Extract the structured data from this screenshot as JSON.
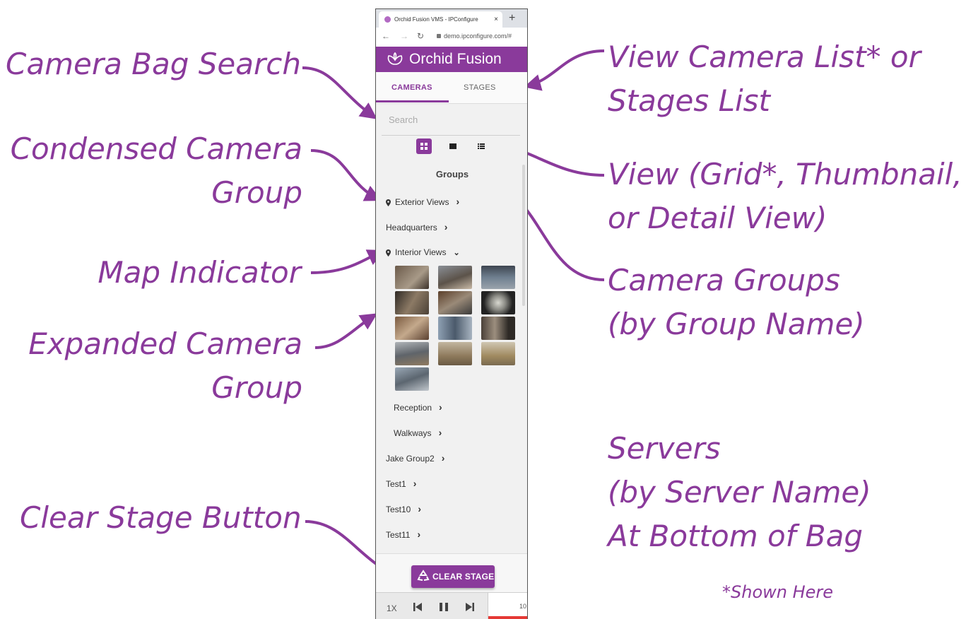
{
  "colors": {
    "accent": "#8a3a9b",
    "clear_stage_bg": "#8a3a9b",
    "timeline_red": "#e53935"
  },
  "callouts": {
    "camera_bag_search": "Camera Bag Search",
    "condensed_1": "Condensed Camera",
    "condensed_2": "Group",
    "map_indicator": "Map Indicator",
    "expanded_1": "Expanded Camera",
    "expanded_2": "Group",
    "clear_stage": "Clear Stage Button",
    "view_list_1": "View Camera List* or",
    "view_list_2": "Stages List",
    "view_mode_1": "View (Grid*, Thumbnail,",
    "view_mode_2": "or Detail View)",
    "camera_groups_1": "Camera Groups",
    "camera_groups_2": "(by Group Name)",
    "servers_1": "Servers",
    "servers_2": "(by Server Name)",
    "servers_3": "At Bottom of Bag",
    "shown_here": "*Shown Here"
  },
  "browser": {
    "tab_title": "Orchid Fusion VMS - IPConfigure",
    "tab_close": "×",
    "new_tab": "+",
    "url": "demo.ipconfigure.com/#"
  },
  "app": {
    "title": "Orchid Fusion",
    "tabs": [
      "CAMERAS",
      "STAGES"
    ],
    "search_placeholder": "Search",
    "view_modes": [
      "grid-view-icon",
      "thumbnail-view-icon",
      "detail-view-icon"
    ],
    "groups_heading": "Groups",
    "groups": [
      {
        "name": "Exterior Views",
        "map": true
      },
      {
        "name": "Headquarters",
        "map": false
      },
      {
        "name": "Interior Views",
        "map": true,
        "expanded": true
      },
      {
        "name": "Reception",
        "map": false
      },
      {
        "name": "Walkways",
        "map": false
      },
      {
        "name": "Jake Group2",
        "map": false
      },
      {
        "name": "Test1",
        "map": false
      },
      {
        "name": "Test10",
        "map": false
      },
      {
        "name": "Test11",
        "map": false
      }
    ],
    "thumbnail_count": 13,
    "clear_stage_label": "CLEAR STAGE",
    "player": {
      "speed": "1X",
      "timeline_tick": "10"
    }
  }
}
